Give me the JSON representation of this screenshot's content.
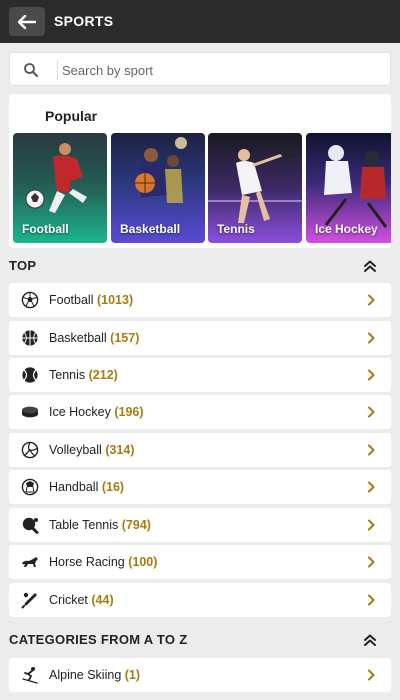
{
  "header": {
    "title": "SPORTS"
  },
  "search": {
    "placeholder": "Search by sport"
  },
  "popular": {
    "title": "Popular",
    "tiles": [
      {
        "label": "Football"
      },
      {
        "label": "Basketball"
      },
      {
        "label": "Tennis"
      },
      {
        "label": "Ice Hockey"
      }
    ]
  },
  "top": {
    "title": "TOP",
    "items": [
      {
        "name": "Football",
        "count": "(1013)",
        "icon": "football-icon"
      },
      {
        "name": "Basketball",
        "count": "(157)",
        "icon": "basketball-icon"
      },
      {
        "name": "Tennis",
        "count": "(212)",
        "icon": "tennis-icon"
      },
      {
        "name": "Ice Hockey",
        "count": "(196)",
        "icon": "ice-hockey-puck-icon"
      },
      {
        "name": "Volleyball",
        "count": "(314)",
        "icon": "volleyball-icon"
      },
      {
        "name": "Handball",
        "count": "(16)",
        "icon": "handball-icon"
      },
      {
        "name": "Table Tennis",
        "count": "(794)",
        "icon": "table-tennis-icon"
      },
      {
        "name": "Horse Racing",
        "count": "(100)",
        "icon": "horse-racing-icon"
      },
      {
        "name": "Cricket",
        "count": "(44)",
        "icon": "cricket-icon"
      }
    ]
  },
  "categories": {
    "title": "CATEGORIES FROM A TO Z",
    "items": [
      {
        "name": "Alpine Skiing",
        "count": "(1)",
        "icon": "skiing-icon"
      }
    ]
  },
  "colors": {
    "count": "#a87b0e",
    "chevron": "#a87b0e",
    "header_bg": "#2b2b2b"
  }
}
